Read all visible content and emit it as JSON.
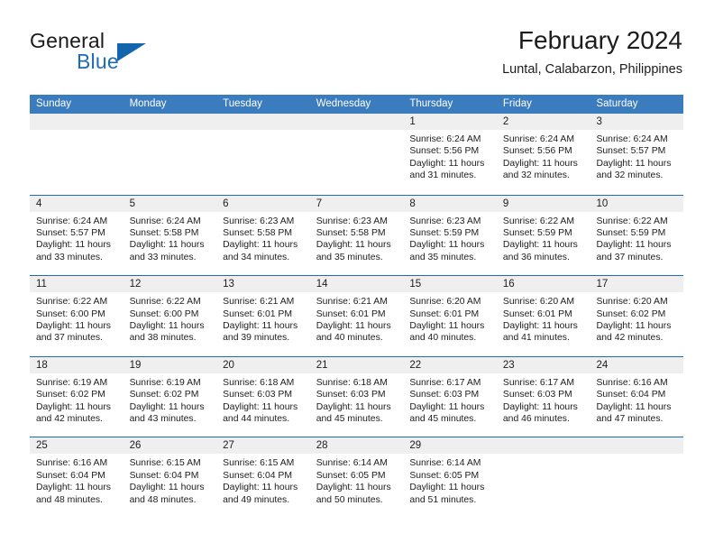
{
  "brand": {
    "name_part1": "General",
    "name_part2": "Blue",
    "accent_color": "#1165ad"
  },
  "header": {
    "month_title": "February 2024",
    "location": "Luntal, Calabarzon, Philippines"
  },
  "theme": {
    "header_row_bg": "#3b7cbf",
    "row_separator": "#1f6cb4",
    "day_band_bg": "#efefef"
  },
  "weekdays": [
    "Sunday",
    "Monday",
    "Tuesday",
    "Wednesday",
    "Thursday",
    "Friday",
    "Saturday"
  ],
  "weeks": [
    [
      {
        "day": "",
        "empty": true
      },
      {
        "day": "",
        "empty": true
      },
      {
        "day": "",
        "empty": true
      },
      {
        "day": "",
        "empty": true
      },
      {
        "day": "1",
        "sunrise": "Sunrise: 6:24 AM",
        "sunset": "Sunset: 5:56 PM",
        "daylight_line1": "Daylight: 11 hours",
        "daylight_line2": "and 31 minutes."
      },
      {
        "day": "2",
        "sunrise": "Sunrise: 6:24 AM",
        "sunset": "Sunset: 5:56 PM",
        "daylight_line1": "Daylight: 11 hours",
        "daylight_line2": "and 32 minutes."
      },
      {
        "day": "3",
        "sunrise": "Sunrise: 6:24 AM",
        "sunset": "Sunset: 5:57 PM",
        "daylight_line1": "Daylight: 11 hours",
        "daylight_line2": "and 32 minutes."
      }
    ],
    [
      {
        "day": "4",
        "sunrise": "Sunrise: 6:24 AM",
        "sunset": "Sunset: 5:57 PM",
        "daylight_line1": "Daylight: 11 hours",
        "daylight_line2": "and 33 minutes."
      },
      {
        "day": "5",
        "sunrise": "Sunrise: 6:24 AM",
        "sunset": "Sunset: 5:58 PM",
        "daylight_line1": "Daylight: 11 hours",
        "daylight_line2": "and 33 minutes."
      },
      {
        "day": "6",
        "sunrise": "Sunrise: 6:23 AM",
        "sunset": "Sunset: 5:58 PM",
        "daylight_line1": "Daylight: 11 hours",
        "daylight_line2": "and 34 minutes."
      },
      {
        "day": "7",
        "sunrise": "Sunrise: 6:23 AM",
        "sunset": "Sunset: 5:58 PM",
        "daylight_line1": "Daylight: 11 hours",
        "daylight_line2": "and 35 minutes."
      },
      {
        "day": "8",
        "sunrise": "Sunrise: 6:23 AM",
        "sunset": "Sunset: 5:59 PM",
        "daylight_line1": "Daylight: 11 hours",
        "daylight_line2": "and 35 minutes."
      },
      {
        "day": "9",
        "sunrise": "Sunrise: 6:22 AM",
        "sunset": "Sunset: 5:59 PM",
        "daylight_line1": "Daylight: 11 hours",
        "daylight_line2": "and 36 minutes."
      },
      {
        "day": "10",
        "sunrise": "Sunrise: 6:22 AM",
        "sunset": "Sunset: 5:59 PM",
        "daylight_line1": "Daylight: 11 hours",
        "daylight_line2": "and 37 minutes."
      }
    ],
    [
      {
        "day": "11",
        "sunrise": "Sunrise: 6:22 AM",
        "sunset": "Sunset: 6:00 PM",
        "daylight_line1": "Daylight: 11 hours",
        "daylight_line2": "and 37 minutes."
      },
      {
        "day": "12",
        "sunrise": "Sunrise: 6:22 AM",
        "sunset": "Sunset: 6:00 PM",
        "daylight_line1": "Daylight: 11 hours",
        "daylight_line2": "and 38 minutes."
      },
      {
        "day": "13",
        "sunrise": "Sunrise: 6:21 AM",
        "sunset": "Sunset: 6:01 PM",
        "daylight_line1": "Daylight: 11 hours",
        "daylight_line2": "and 39 minutes."
      },
      {
        "day": "14",
        "sunrise": "Sunrise: 6:21 AM",
        "sunset": "Sunset: 6:01 PM",
        "daylight_line1": "Daylight: 11 hours",
        "daylight_line2": "and 40 minutes."
      },
      {
        "day": "15",
        "sunrise": "Sunrise: 6:20 AM",
        "sunset": "Sunset: 6:01 PM",
        "daylight_line1": "Daylight: 11 hours",
        "daylight_line2": "and 40 minutes."
      },
      {
        "day": "16",
        "sunrise": "Sunrise: 6:20 AM",
        "sunset": "Sunset: 6:01 PM",
        "daylight_line1": "Daylight: 11 hours",
        "daylight_line2": "and 41 minutes."
      },
      {
        "day": "17",
        "sunrise": "Sunrise: 6:20 AM",
        "sunset": "Sunset: 6:02 PM",
        "daylight_line1": "Daylight: 11 hours",
        "daylight_line2": "and 42 minutes."
      }
    ],
    [
      {
        "day": "18",
        "sunrise": "Sunrise: 6:19 AM",
        "sunset": "Sunset: 6:02 PM",
        "daylight_line1": "Daylight: 11 hours",
        "daylight_line2": "and 42 minutes."
      },
      {
        "day": "19",
        "sunrise": "Sunrise: 6:19 AM",
        "sunset": "Sunset: 6:02 PM",
        "daylight_line1": "Daylight: 11 hours",
        "daylight_line2": "and 43 minutes."
      },
      {
        "day": "20",
        "sunrise": "Sunrise: 6:18 AM",
        "sunset": "Sunset: 6:03 PM",
        "daylight_line1": "Daylight: 11 hours",
        "daylight_line2": "and 44 minutes."
      },
      {
        "day": "21",
        "sunrise": "Sunrise: 6:18 AM",
        "sunset": "Sunset: 6:03 PM",
        "daylight_line1": "Daylight: 11 hours",
        "daylight_line2": "and 45 minutes."
      },
      {
        "day": "22",
        "sunrise": "Sunrise: 6:17 AM",
        "sunset": "Sunset: 6:03 PM",
        "daylight_line1": "Daylight: 11 hours",
        "daylight_line2": "and 45 minutes."
      },
      {
        "day": "23",
        "sunrise": "Sunrise: 6:17 AM",
        "sunset": "Sunset: 6:03 PM",
        "daylight_line1": "Daylight: 11 hours",
        "daylight_line2": "and 46 minutes."
      },
      {
        "day": "24",
        "sunrise": "Sunrise: 6:16 AM",
        "sunset": "Sunset: 6:04 PM",
        "daylight_line1": "Daylight: 11 hours",
        "daylight_line2": "and 47 minutes."
      }
    ],
    [
      {
        "day": "25",
        "sunrise": "Sunrise: 6:16 AM",
        "sunset": "Sunset: 6:04 PM",
        "daylight_line1": "Daylight: 11 hours",
        "daylight_line2": "and 48 minutes."
      },
      {
        "day": "26",
        "sunrise": "Sunrise: 6:15 AM",
        "sunset": "Sunset: 6:04 PM",
        "daylight_line1": "Daylight: 11 hours",
        "daylight_line2": "and 48 minutes."
      },
      {
        "day": "27",
        "sunrise": "Sunrise: 6:15 AM",
        "sunset": "Sunset: 6:04 PM",
        "daylight_line1": "Daylight: 11 hours",
        "daylight_line2": "and 49 minutes."
      },
      {
        "day": "28",
        "sunrise": "Sunrise: 6:14 AM",
        "sunset": "Sunset: 6:05 PM",
        "daylight_line1": "Daylight: 11 hours",
        "daylight_line2": "and 50 minutes."
      },
      {
        "day": "29",
        "sunrise": "Sunrise: 6:14 AM",
        "sunset": "Sunset: 6:05 PM",
        "daylight_line1": "Daylight: 11 hours",
        "daylight_line2": "and 51 minutes."
      },
      {
        "day": "",
        "empty": true
      },
      {
        "day": "",
        "empty": true
      }
    ]
  ]
}
